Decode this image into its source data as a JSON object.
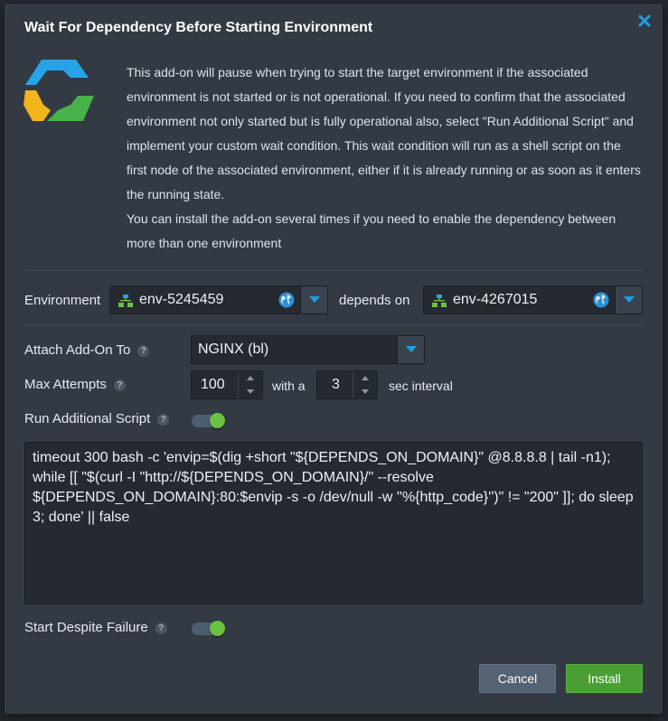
{
  "dialog": {
    "title": "Wait For Dependency Before Starting Environment"
  },
  "description": {
    "paragraph_1": "This add-on will pause when trying to start the target environment if the associated environment is not started or is not operational. If you need to confirm that the associated environment not only started but is fully operational also, select \"Run Additional Script\" and implement your custom wait condition. This wait condition will run as a shell script on the first node of the associated environment, either if it is already running or as soon as it enters the running state.",
    "paragraph_2": "You can install the add-on several times if you need to enable the dependency between more than one environment"
  },
  "environment_row": {
    "label": "Environment",
    "source_env": "env-5245459",
    "connector_text": "depends on",
    "target_env": "env-4267015"
  },
  "attach": {
    "label": "Attach Add-On To",
    "value": "NGINX (bl)"
  },
  "attempts": {
    "label": "Max Attempts",
    "max_attempts": "100",
    "with_a": "with a",
    "interval": "3",
    "interval_suffix": "sec interval"
  },
  "run_script": {
    "label": "Run Additional Script",
    "enabled": true,
    "script": "timeout 300 bash -c 'envip=$(dig +short \"${DEPENDS_ON_DOMAIN}\" @8.8.8.8 | tail -n1); while [[ \"$(curl -I \"http://${DEPENDS_ON_DOMAIN}/\" --resolve ${DEPENDS_ON_DOMAIN}:80:$envip -s -o /dev/null -w ''%{http_code}'')\" != \"200\" ]]; do sleep 3; done' || false"
  },
  "start_despite_failure": {
    "label": "Start Despite Failure",
    "enabled": true
  },
  "help_glyph": "?",
  "buttons": {
    "cancel": "Cancel",
    "install": "Install"
  },
  "colors": {
    "accent_blue": "#1d9ee8",
    "install_green": "#4a9e34",
    "toggle_on": "#6bc142"
  },
  "icons": [
    "close-icon",
    "addon-logo-icon",
    "environment-icon",
    "globe-icon",
    "chevron-down-icon",
    "help-icon",
    "spinner-up-icon",
    "spinner-down-icon"
  ]
}
